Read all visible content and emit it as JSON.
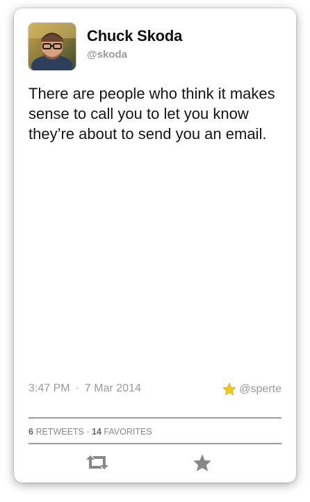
{
  "user": {
    "name": "Chuck Skoda",
    "handle": "@skoda"
  },
  "tweet": {
    "text": "There are people who think it makes sense to call you to let you know they’re about to send you an email.",
    "time": "3:47 PM",
    "separator": "·",
    "date": "7 Mar 2014",
    "favorited_by": "@sperte"
  },
  "stats": {
    "retweets_count": "6",
    "retweets_label": "RETWEETS",
    "separator": "·",
    "favorites_count": "14",
    "favorites_label": "FAVORITES"
  },
  "actions": {
    "retweet_icon": "retweet-icon",
    "favorite_icon": "star-icon"
  },
  "colors": {
    "star_gold": "#f5c518",
    "muted_gray": "#9a9a9a",
    "divider": "#9c9c9c",
    "text": "#141414"
  }
}
